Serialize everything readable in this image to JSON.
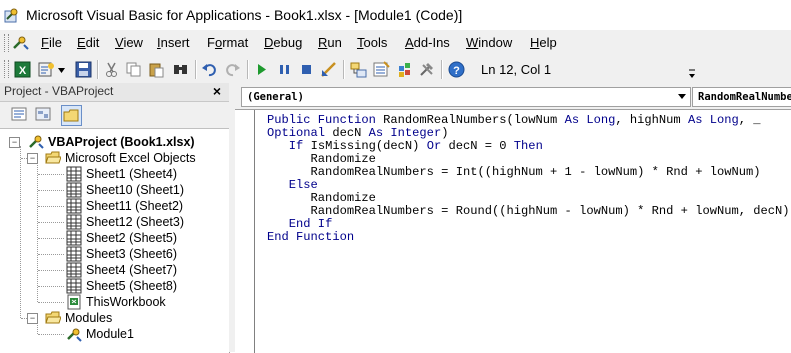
{
  "window": {
    "title": "Microsoft Visual Basic for Applications - Book1.xlsx - [Module1 (Code)]"
  },
  "menu": {
    "items": [
      {
        "pre": "",
        "u": "F",
        "post": "ile"
      },
      {
        "pre": "",
        "u": "E",
        "post": "dit"
      },
      {
        "pre": "",
        "u": "V",
        "post": "iew"
      },
      {
        "pre": "",
        "u": "I",
        "post": "nsert"
      },
      {
        "pre": "F",
        "u": "o",
        "post": "rmat"
      },
      {
        "pre": "",
        "u": "D",
        "post": "ebug"
      },
      {
        "pre": "",
        "u": "R",
        "post": "un"
      },
      {
        "pre": "",
        "u": "T",
        "post": "ools"
      },
      {
        "pre": "",
        "u": "A",
        "post": "dd-Ins"
      },
      {
        "pre": "",
        "u": "W",
        "post": "indow"
      },
      {
        "pre": "",
        "u": "H",
        "post": "elp"
      }
    ]
  },
  "toolbar": {
    "cursor_position": "Ln 12, Col 1",
    "icons": [
      "excel-view-icon",
      "insert-module-icon",
      "save-icon",
      "cut-icon",
      "copy-icon",
      "paste-icon",
      "find-icon",
      "undo-icon",
      "redo-icon",
      "run-icon",
      "break-icon",
      "reset-icon",
      "design-mode-icon",
      "project-explorer-icon",
      "properties-icon",
      "object-browser-icon",
      "toolbox-icon",
      "help-icon"
    ]
  },
  "project_pane": {
    "title": "Project - VBAProject",
    "close_label": "×",
    "tree": {
      "root": "VBAProject (Book1.xlsx)",
      "excel_objects_folder": "Microsoft Excel Objects",
      "sheets": [
        "Sheet1 (Sheet4)",
        "Sheet10 (Sheet1)",
        "Sheet11 (Sheet2)",
        "Sheet12 (Sheet3)",
        "Sheet2 (Sheet5)",
        "Sheet3 (Sheet6)",
        "Sheet4 (Sheet7)",
        "Sheet5 (Sheet8)"
      ],
      "workbook": "ThisWorkbook",
      "modules_folder": "Modules",
      "module": "Module1"
    }
  },
  "code_pane": {
    "object_combo": "(General)",
    "procedure_combo": "RandomRealNumbers",
    "lines": [
      [
        {
          "t": "Public Function ",
          "k": true
        },
        {
          "t": "RandomRealNumbers(lowNum "
        },
        {
          "t": "As Long",
          "k": true
        },
        {
          "t": ", highNum "
        },
        {
          "t": "As Long",
          "k": true
        },
        {
          "t": ", _"
        }
      ],
      [
        {
          "t": "Optional ",
          "k": true
        },
        {
          "t": "decN "
        },
        {
          "t": "As Integer",
          "k": true
        },
        {
          "t": ")"
        }
      ],
      [
        {
          "t": "   "
        },
        {
          "t": "If ",
          "k": true
        },
        {
          "t": "IsMissing(decN) "
        },
        {
          "t": "Or ",
          "k": true
        },
        {
          "t": "decN = 0 "
        },
        {
          "t": "Then",
          "k": true
        }
      ],
      [
        {
          "t": "      Randomize"
        }
      ],
      [
        {
          "t": "      RandomRealNumbers = Int((highNum + 1 - lowNum) * Rnd + lowNum)"
        }
      ],
      [
        {
          "t": "   "
        },
        {
          "t": "Else",
          "k": true
        }
      ],
      [
        {
          "t": "      Randomize"
        }
      ],
      [
        {
          "t": "      RandomRealNumbers = Round((highNum - lowNum) * Rnd + lowNum, decN)"
        }
      ],
      [
        {
          "t": "   "
        },
        {
          "t": "End If",
          "k": true
        }
      ],
      [
        {
          "t": "End Function",
          "k": true
        }
      ]
    ]
  }
}
